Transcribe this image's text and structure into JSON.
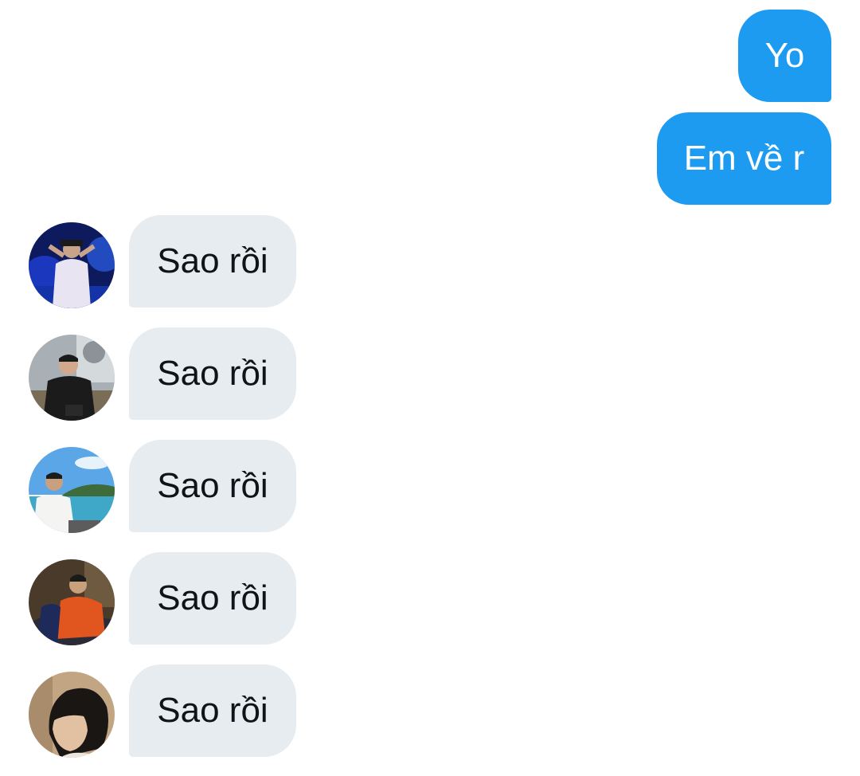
{
  "conversation": {
    "sent": [
      {
        "text": "Yo"
      },
      {
        "text": "Em về r"
      }
    ],
    "received": [
      {
        "text": "Sao rồi",
        "avatar": "user-avatar-photo"
      },
      {
        "text": "Sao rồi",
        "avatar": "user-avatar-photo"
      },
      {
        "text": "Sao rồi",
        "avatar": "user-avatar-photo"
      },
      {
        "text": "Sao rồi",
        "avatar": "user-avatar-photo"
      },
      {
        "text": "Sao rồi",
        "avatar": "user-avatar-photo"
      }
    ]
  },
  "colors": {
    "sent_bubble": "#1d9bf0",
    "received_bubble": "#e7ecf0",
    "sent_text": "#ffffff",
    "received_text": "#0f1419",
    "background": "#ffffff"
  }
}
